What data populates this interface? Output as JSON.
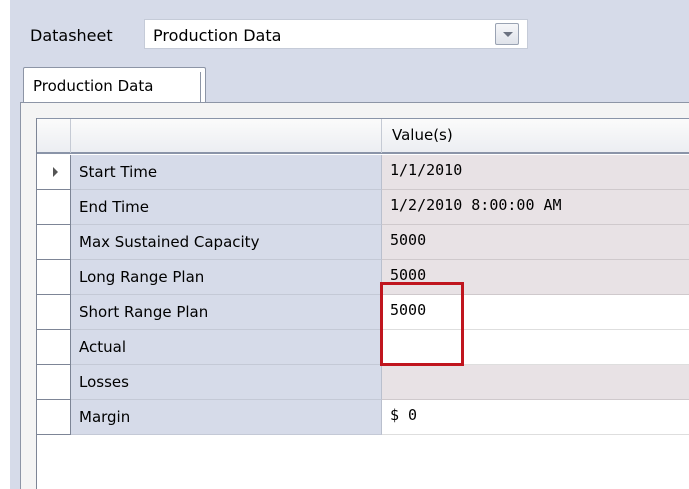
{
  "datasheet": {
    "label": "Datasheet",
    "selected": "Production Data"
  },
  "tabs": [
    {
      "label": "Production Data",
      "active": true
    }
  ],
  "grid": {
    "columns": [
      "",
      "Value(s)"
    ],
    "rows": [
      {
        "name": "Start Time",
        "value": "1/1/2010",
        "current": true
      },
      {
        "name": "End Time",
        "value": "1/2/2010 8:00:00 AM"
      },
      {
        "name": "Max Sustained Capacity",
        "value": "5000"
      },
      {
        "name": "Long Range Plan",
        "value": "5000"
      },
      {
        "name": "Short Range Plan",
        "value": "5000"
      },
      {
        "name": "Actual",
        "value": ""
      },
      {
        "name": "Losses",
        "value": ""
      },
      {
        "name": "Margin",
        "value": "$ 0"
      }
    ]
  },
  "colors": {
    "panel": "#d6dbe9",
    "readonly_value": "#e8e2e5",
    "editable_value": "#ffffff",
    "highlight": "#c0151e"
  }
}
